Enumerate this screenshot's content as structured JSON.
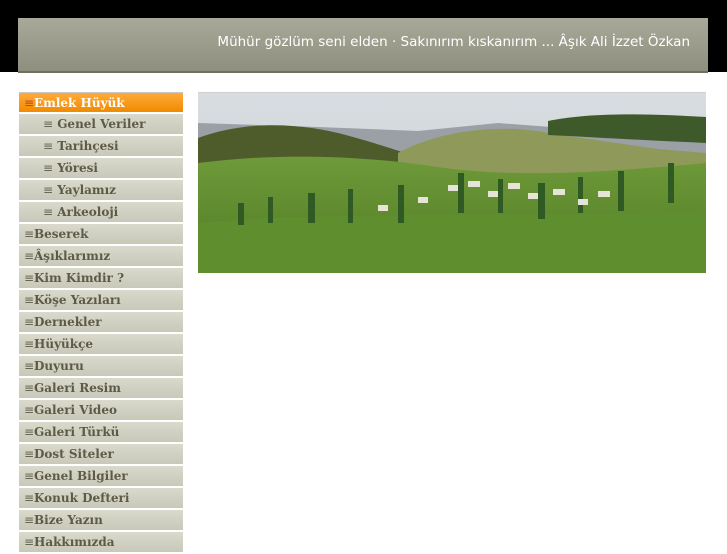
{
  "header": {
    "quote": "Mühür gözlüm seni elden · Sakınırım kıskanırım ... Âşık Ali İzzet Özkan"
  },
  "sidebar": {
    "items": [
      {
        "label": "Emlek Hüyük",
        "active": true
      },
      {
        "label": "Genel Veriler",
        "sub": true
      },
      {
        "label": "Tarihçesi",
        "sub": true
      },
      {
        "label": "Yöresi",
        "sub": true
      },
      {
        "label": "Yaylamız",
        "sub": true
      },
      {
        "label": "Arkeoloji",
        "sub": true
      },
      {
        "label": "Beserek"
      },
      {
        "label": "Âşıklarımız"
      },
      {
        "label": "Kim Kimdir ?"
      },
      {
        "label": "Köşe Yazıları"
      },
      {
        "label": "Dernekler"
      },
      {
        "label": "Hüyükçe"
      },
      {
        "label": "Duyuru"
      },
      {
        "label": "Galeri Resim"
      },
      {
        "label": "Galeri Video"
      },
      {
        "label": "Galeri Türkü"
      },
      {
        "label": "Dost Siteler"
      },
      {
        "label": "Genel Bilgiler"
      },
      {
        "label": "Konuk Defteri"
      },
      {
        "label": "Bize Yazın"
      },
      {
        "label": "Hakkımızda"
      }
    ],
    "bullet": "≡"
  },
  "colors": {
    "active": "#f7941d",
    "nav_bg": "#d4d4c6",
    "nav_text": "#5d5a45",
    "header_bg": "#9d9d8d"
  }
}
